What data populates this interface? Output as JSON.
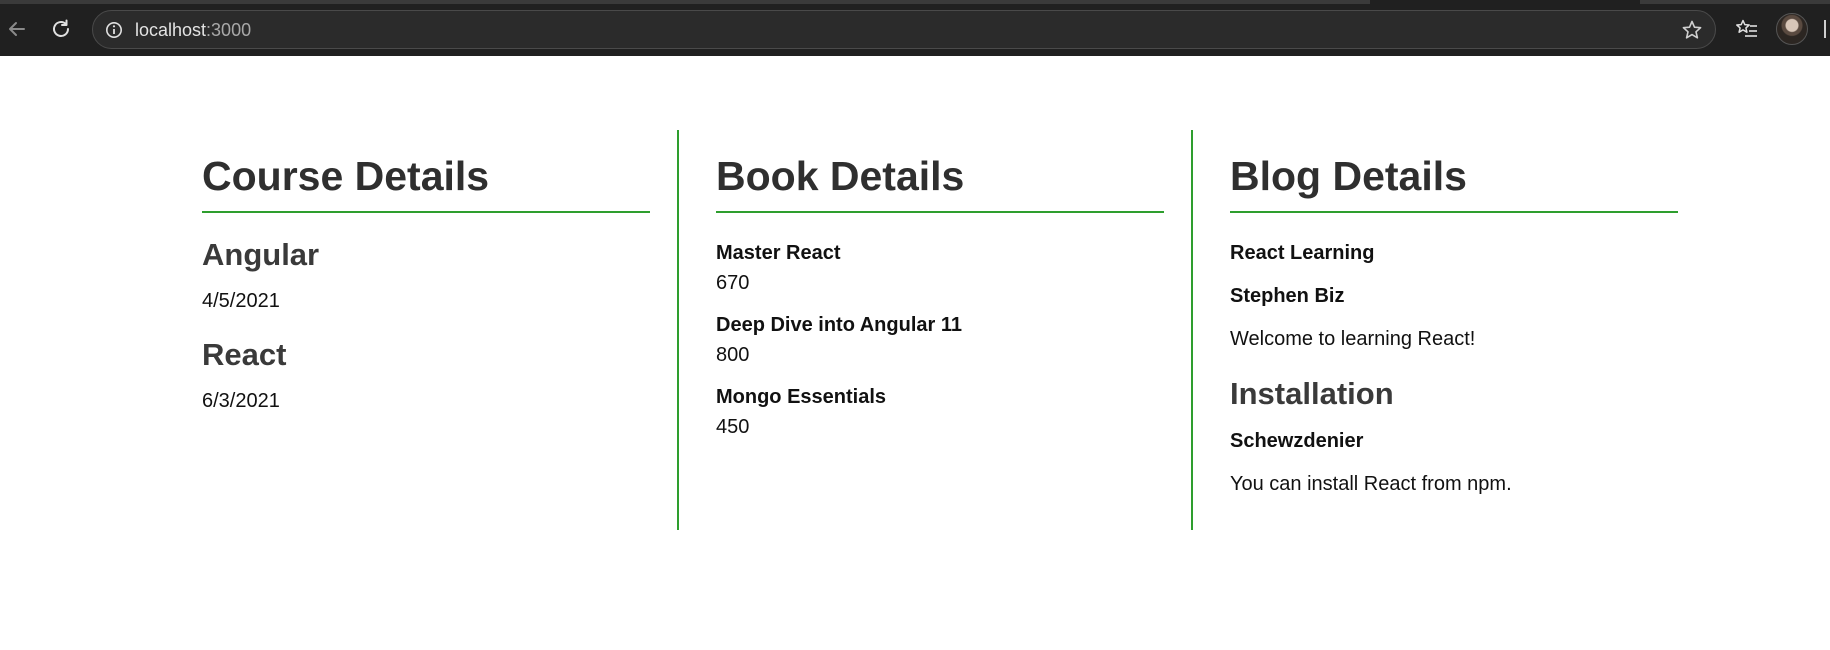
{
  "browser": {
    "url_host": "localhost",
    "url_port": ":3000"
  },
  "course": {
    "heading": "Course Details",
    "items": [
      {
        "name": "Angular",
        "date": "4/5/2021"
      },
      {
        "name": "React",
        "date": "6/3/2021"
      }
    ]
  },
  "book": {
    "heading": "Book Details",
    "items": [
      {
        "title": "Master React",
        "price": "670"
      },
      {
        "title": "Deep Dive into Angular 11",
        "price": "800"
      },
      {
        "title": "Mongo Essentials",
        "price": "450"
      }
    ]
  },
  "blog": {
    "heading": "Blog Details",
    "items": [
      {
        "title": "React Learning",
        "author": "Stephen Biz",
        "content": "Welcome to learning React!"
      },
      {
        "title": "Installation",
        "author": "Schewzdenier",
        "content": "You can install React from npm."
      }
    ]
  },
  "colors": {
    "accent_green": "#2e9e2e",
    "chrome_bg": "#202020"
  },
  "icons": [
    "back-arrow-icon",
    "reload-icon",
    "info-icon",
    "star-icon",
    "favorites-icon"
  ]
}
